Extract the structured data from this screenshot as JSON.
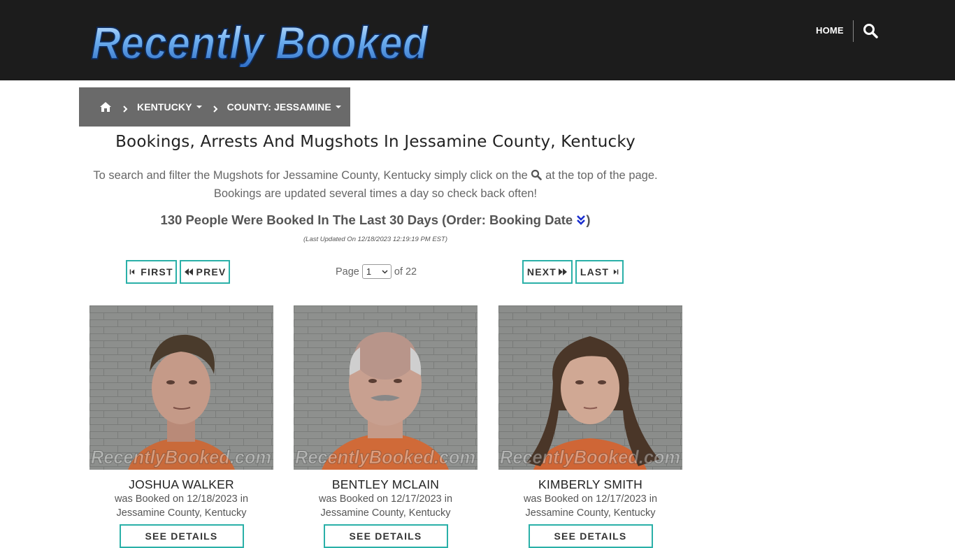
{
  "header": {
    "logo_text": "Recently Booked",
    "nav_home": "HOME",
    "search_icon": "search-icon"
  },
  "breadcrumb": {
    "home_icon": "home-icon",
    "items": [
      {
        "label": "KENTUCKY"
      },
      {
        "label": "COUNTY: JESSAMINE"
      }
    ]
  },
  "main": {
    "title": "Bookings, Arrests And Mugshots In Jessamine County, Kentucky",
    "intro_part1": "To search and filter the Mugshots for Jessamine County, Kentucky simply click on the",
    "intro_part2": "at the top of the page.",
    "intro_line2": "Bookings are updated several times a day so check back often!",
    "count_text": "130 People Were Booked In The Last 30 Days (Order: Booking Date",
    "count_close": ")",
    "last_updated": "(Last Updated On 12/18/2023 12:19:19 PM EST)"
  },
  "pager": {
    "first": "FIRST",
    "prev": "PREV",
    "next": "NEXT",
    "last": "LAST",
    "page_label": "Page",
    "page_value": "1",
    "of_label": "of 22"
  },
  "watermark": "RecentlyBooked.com",
  "people": [
    {
      "name": "JOSHUA WALKER",
      "line1": "was Booked on 12/18/2023 in",
      "line2": "Jessamine County, Kentucky",
      "button": "SEE DETAILS"
    },
    {
      "name": "BENTLEY MCLAIN",
      "line1": "was Booked on 12/17/2023 in",
      "line2": "Jessamine County, Kentucky",
      "button": "SEE DETAILS"
    },
    {
      "name": "KIMBERLY SMITH",
      "line1": "was Booked on 12/17/2023 in",
      "line2": "Jessamine County, Kentucky",
      "button": "SEE DETAILS"
    }
  ],
  "colors": {
    "header_bg": "#1c1c1c",
    "breadcrumb_bg": "#6a6a6a",
    "button_border": "#2ab0a8",
    "logo_blue": "#4a90e0",
    "order_icon": "#1a2ed0"
  }
}
